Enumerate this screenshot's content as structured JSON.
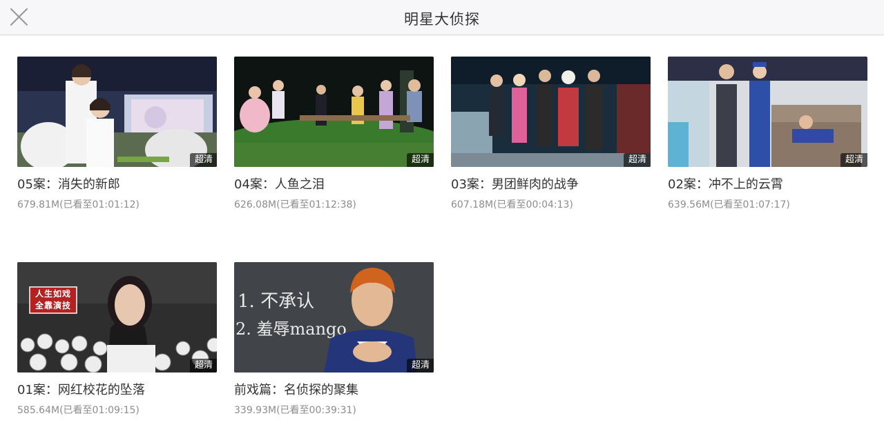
{
  "header": {
    "title": "明星大侦探"
  },
  "icons": {
    "close": "close-icon"
  },
  "badge_label": "超清",
  "episodes": [
    {
      "title": "05案：消失的新郎",
      "size": "679.81M",
      "progress": "(已看至01:01:12)",
      "badge": "超清"
    },
    {
      "title": "04案：人鱼之泪",
      "size": "626.08M",
      "progress": "(已看至01:12:38)",
      "badge": "超清"
    },
    {
      "title": "03案：男团鲜肉的战争",
      "size": "607.18M",
      "progress": "(已看至00:04:13)",
      "badge": "超清"
    },
    {
      "title": "02案：冲不上的云霄",
      "size": "639.56M",
      "progress": "(已看至01:07:17)",
      "badge": "超清"
    },
    {
      "title": "01案：网红校花的坠落",
      "size": "585.64M",
      "progress": "(已看至01:09:15)",
      "badge": "超清",
      "caption": "人生如戏 全靠演技"
    },
    {
      "title": "前戏篇：名侦探的聚集",
      "size": "339.93M",
      "progress": "(已看至00:39:31)",
      "badge": "超清",
      "chalk_lines": [
        "1. 不承认",
        "2. 羞辱mango"
      ]
    }
  ]
}
